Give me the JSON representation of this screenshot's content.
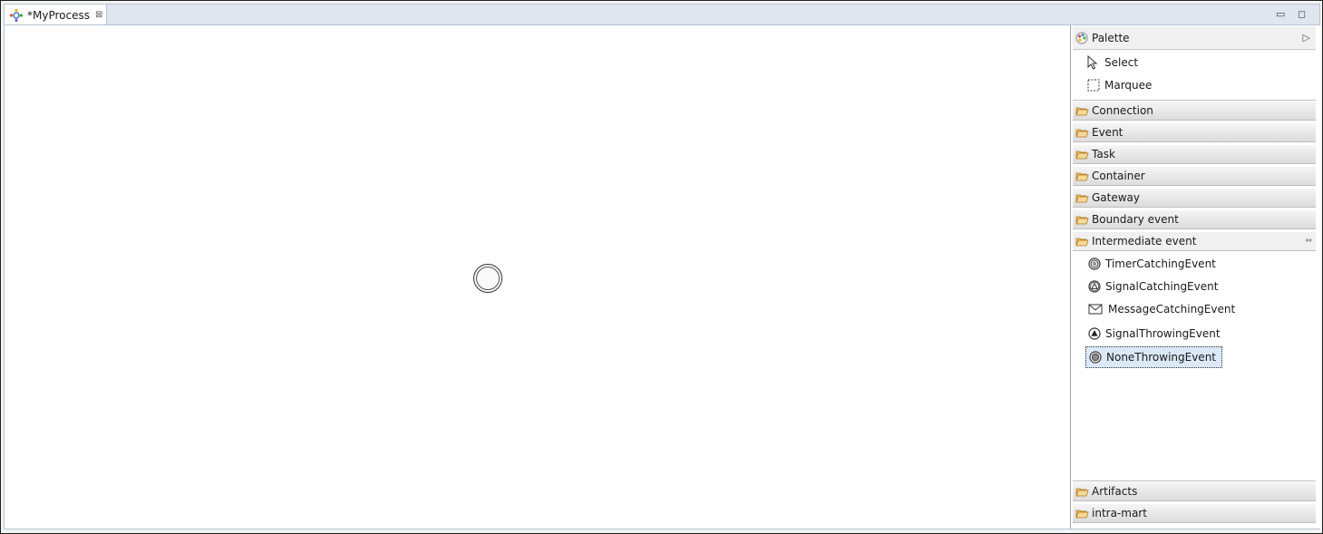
{
  "editor": {
    "tab_title": "*MyProcess",
    "close_glyph": "⊠",
    "minimize_glyph": "▭",
    "maximize_glyph": "◻"
  },
  "palette": {
    "title": "Palette",
    "collapse_glyph": "▷",
    "tools": [
      {
        "label": "Select",
        "icon": "arrow-pointer-icon"
      },
      {
        "label": "Marquee",
        "icon": "marquee-icon"
      }
    ],
    "drawers": [
      {
        "label": "Connection"
      },
      {
        "label": "Event"
      },
      {
        "label": "Task"
      },
      {
        "label": "Container"
      },
      {
        "label": "Gateway"
      },
      {
        "label": "Boundary event"
      },
      {
        "label": "Intermediate event",
        "open": true
      }
    ],
    "intermediate_entries": [
      {
        "label": "TimerCatchingEvent",
        "icon": "timer-event-icon"
      },
      {
        "label": "SignalCatchingEvent",
        "icon": "signal-catch-icon"
      },
      {
        "label": "MessageCatchingEvent",
        "icon": "envelope-icon"
      },
      {
        "label": "SignalThrowingEvent",
        "icon": "signal-throw-icon"
      },
      {
        "label": "NoneThrowingEvent",
        "icon": "none-throw-icon",
        "selected": true
      }
    ],
    "bottom_drawers": [
      {
        "label": "Artifacts"
      },
      {
        "label": "intra-mart"
      }
    ]
  },
  "colors": {
    "selection_bg": "#dbe8f8",
    "folder": "#e9a84b"
  }
}
